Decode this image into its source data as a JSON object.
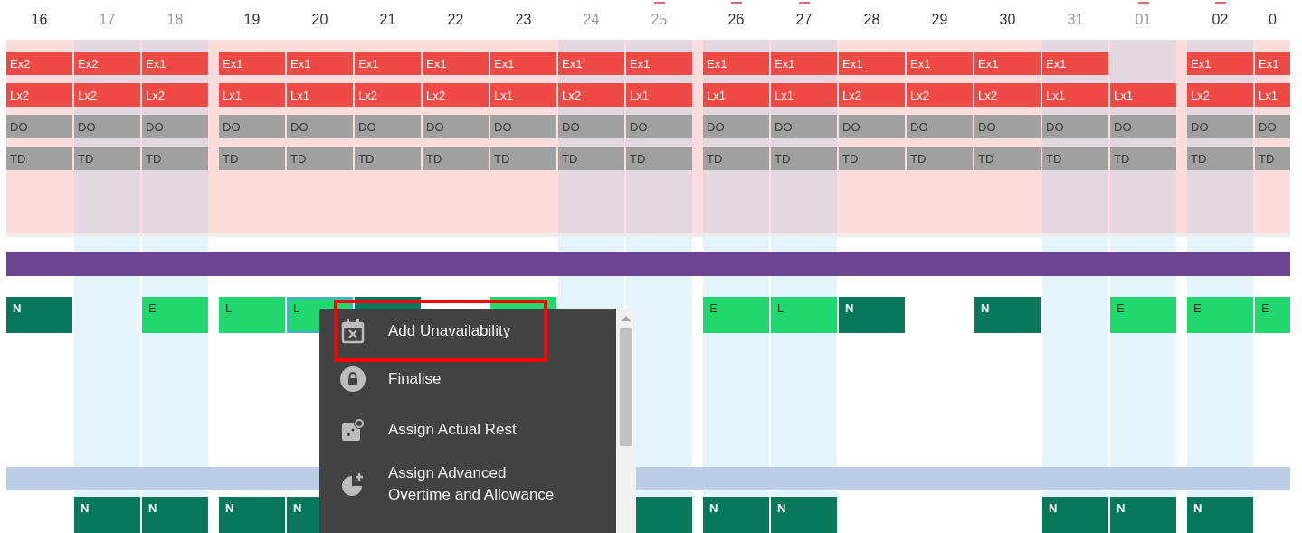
{
  "weeks": [
    {
      "days": [
        {
          "label": "16",
          "muted": false,
          "shaded": false,
          "marked": false,
          "ex": "Ex2",
          "lx": "Lx2",
          "do": "DO",
          "td": "TD",
          "shift1": {
            "label": "N",
            "kind": "night",
            "selected": false
          }
        },
        {
          "label": "17",
          "muted": true,
          "shaded": true,
          "marked": false,
          "ex": "Ex2",
          "lx": "Lx2",
          "do": "DO",
          "td": "TD",
          "shift2": {
            "label": "N",
            "kind": "night",
            "selected": false
          }
        },
        {
          "label": "18",
          "muted": true,
          "shaded": true,
          "marked": false,
          "ex": "Ex1",
          "lx": "Lx2",
          "do": "DO",
          "td": "TD",
          "shift1": {
            "label": "E",
            "kind": "early",
            "selected": false
          },
          "shift2": {
            "label": "N",
            "kind": "night",
            "selected": false
          }
        }
      ]
    },
    {
      "days": [
        {
          "label": "19",
          "muted": false,
          "shaded": false,
          "marked": false,
          "ex": "Ex1",
          "lx": "Lx1",
          "do": "DO",
          "td": "TD",
          "shift1": {
            "label": "L",
            "kind": "late",
            "selected": false
          },
          "shift2": {
            "label": "N",
            "kind": "night",
            "selected": false
          }
        },
        {
          "label": "20",
          "muted": false,
          "shaded": false,
          "marked": false,
          "ex": "Ex1",
          "lx": "Lx1",
          "do": "DO",
          "td": "TD",
          "shift1": {
            "label": "L",
            "kind": "late",
            "selected": true
          },
          "shift2": {
            "label": "N",
            "kind": "night",
            "selected": false
          }
        },
        {
          "label": "21",
          "muted": false,
          "shaded": false,
          "marked": false,
          "ex": "Ex1",
          "lx": "Lx2",
          "do": "DO",
          "td": "TD",
          "shift1": {
            "kind": "night",
            "selected": false
          }
        },
        {
          "label": "22",
          "muted": false,
          "shaded": false,
          "marked": false,
          "ex": "Ex1",
          "lx": "Lx2",
          "do": "DO",
          "td": "TD"
        },
        {
          "label": "23",
          "muted": false,
          "shaded": false,
          "marked": false,
          "ex": "Ex1",
          "lx": "Lx1",
          "do": "DO",
          "td": "TD",
          "shift1": {
            "kind": "early",
            "selected": false
          }
        },
        {
          "label": "24",
          "muted": true,
          "shaded": true,
          "marked": false,
          "ex": "Ex1",
          "lx": "Lx2",
          "do": "DO",
          "td": "TD"
        },
        {
          "label": "25",
          "muted": true,
          "shaded": true,
          "marked": true,
          "ex": "Ex1",
          "lx": "Lx1",
          "do": "DO",
          "td": "TD",
          "shift2": {
            "kind": "night",
            "selected": false
          }
        }
      ]
    },
    {
      "days": [
        {
          "label": "26",
          "muted": false,
          "shaded": true,
          "marked": true,
          "ex": "Ex1",
          "lx": "Lx1",
          "do": "DO",
          "td": "TD",
          "shift1": {
            "label": "E",
            "kind": "early",
            "selected": false
          },
          "shift2": {
            "label": "N",
            "kind": "night",
            "selected": false
          }
        },
        {
          "label": "27",
          "muted": false,
          "shaded": true,
          "marked": true,
          "ex": "Ex1",
          "lx": "Lx1",
          "do": "DO",
          "td": "TD",
          "shift1": {
            "label": "L",
            "kind": "late",
            "selected": false
          },
          "shift2": {
            "label": "N",
            "kind": "night",
            "selected": false
          }
        },
        {
          "label": "28",
          "muted": false,
          "shaded": false,
          "marked": false,
          "ex": "Ex1",
          "lx": "Lx2",
          "do": "DO",
          "td": "TD",
          "shift1": {
            "label": "N",
            "kind": "night",
            "selected": false
          }
        },
        {
          "label": "29",
          "muted": false,
          "shaded": false,
          "marked": false,
          "ex": "Ex1",
          "lx": "Lx2",
          "do": "DO",
          "td": "TD"
        },
        {
          "label": "30",
          "muted": false,
          "shaded": false,
          "marked": false,
          "ex": "Ex1",
          "lx": "Lx2",
          "do": "DO",
          "td": "TD",
          "shift1": {
            "label": "N",
            "kind": "night",
            "selected": false
          }
        },
        {
          "label": "31",
          "muted": true,
          "shaded": true,
          "marked": false,
          "ex": "Ex1",
          "lx": "Lx1",
          "do": "DO",
          "td": "TD",
          "shift2": {
            "label": "N",
            "kind": "night",
            "selected": false
          }
        },
        {
          "label": "01",
          "muted": true,
          "shaded": true,
          "marked": true,
          "lx": "Lx1",
          "do": "DO",
          "td": "TD",
          "shift1": {
            "label": "E",
            "kind": "early",
            "selected": false
          },
          "shift2": {
            "label": "N",
            "kind": "night",
            "selected": false
          }
        }
      ]
    },
    {
      "days": [
        {
          "label": "02",
          "muted": false,
          "shaded": true,
          "marked": true,
          "ex": "Ex1",
          "lx": "Lx2",
          "do": "DO",
          "td": "TD",
          "shift1": {
            "label": "E",
            "kind": "early",
            "selected": false
          },
          "shift2": {
            "label": "N",
            "kind": "night",
            "selected": false
          }
        },
        {
          "label": "0",
          "muted": false,
          "shaded": false,
          "marked": false,
          "ex": "Ex1",
          "lx": "Lx1",
          "do": "DO",
          "td": "TD",
          "shift1": {
            "label": "E",
            "kind": "early",
            "selected": false
          }
        }
      ]
    }
  ],
  "menu": {
    "items": [
      {
        "label": "Add Unavailability",
        "kind": "calendar",
        "highlighted": true
      },
      {
        "label": "Finalise",
        "kind": "lock",
        "highlighted": false
      },
      {
        "label": "Assign Actual Rest",
        "kind": "rest",
        "highlighted": false
      },
      {
        "label": "Assign Advanced Overtime and Allowance",
        "kind": "pie",
        "highlighted": false
      }
    ]
  }
}
